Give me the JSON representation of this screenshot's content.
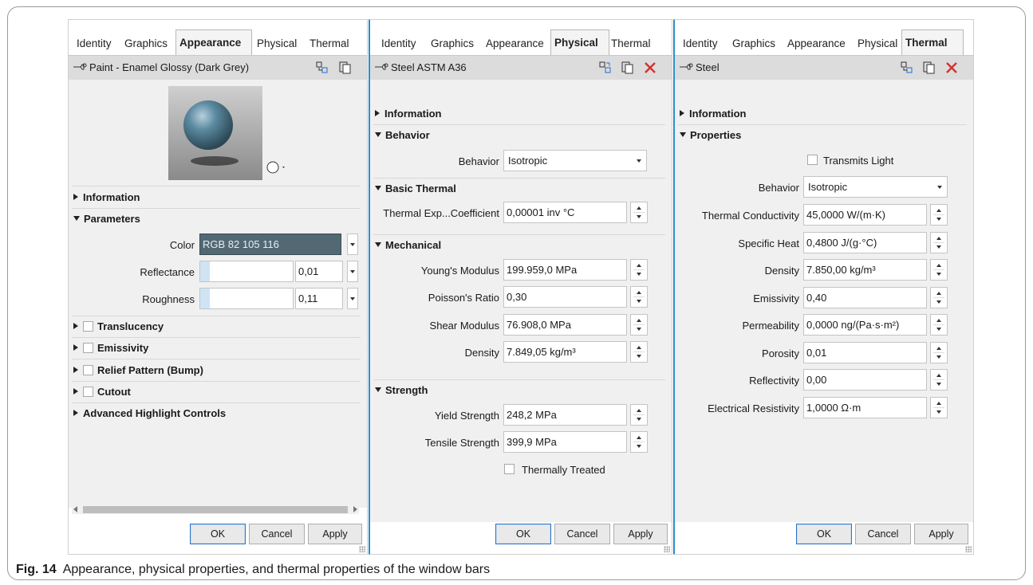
{
  "panel1": {
    "tabs": [
      "Identity",
      "Graphics",
      "Appearance",
      "Physical",
      "Thermal"
    ],
    "active_tab": "Appearance",
    "material_name": "Paint - Enamel Glossy (Dark Grey)",
    "sections": {
      "information": "Information",
      "parameters": "Parameters",
      "translucency": "Translucency",
      "emissivity": "Emissivity",
      "relief": "Relief Pattern (Bump)",
      "cutout": "Cutout",
      "advanced": "Advanced Highlight Controls"
    },
    "color_label": "Color",
    "color_value": "RGB 82 105 116",
    "color_swatch": "#526974",
    "reflectance_label": "Reflectance",
    "reflectance_value": "0,01",
    "roughness_label": "Roughness",
    "roughness_value": "0,11",
    "buttons": {
      "ok": "OK",
      "cancel": "Cancel",
      "apply": "Apply"
    }
  },
  "panel2": {
    "tabs": [
      "Identity",
      "Graphics",
      "Appearance",
      "Physical",
      "Thermal"
    ],
    "active_tab": "Physical",
    "material_name": "Steel ASTM A36",
    "sections": {
      "information": "Information",
      "behavior": "Behavior",
      "basic_thermal": "Basic Thermal",
      "mechanical": "Mechanical",
      "strength": "Strength"
    },
    "behavior_label": "Behavior",
    "behavior_value": "Isotropic",
    "thermal_exp_label": "Thermal Exp...Coefficient",
    "thermal_exp_value": "0,00001 inv °C",
    "youngs_label": "Young's Modulus",
    "youngs_value": "199.959,0 MPa",
    "poisson_label": "Poisson's Ratio",
    "poisson_value": "0,30",
    "shear_label": "Shear Modulus",
    "shear_value": "76.908,0 MPa",
    "density_label": "Density",
    "density_value": "7.849,05 kg/m³",
    "yield_label": "Yield Strength",
    "yield_value": "248,2 MPa",
    "tensile_label": "Tensile Strength",
    "tensile_value": "399,9 MPa",
    "thermally_treated": "Thermally Treated",
    "buttons": {
      "ok": "OK",
      "cancel": "Cancel",
      "apply": "Apply"
    }
  },
  "panel3": {
    "tabs": [
      "Identity",
      "Graphics",
      "Appearance",
      "Physical",
      "Thermal"
    ],
    "active_tab": "Thermal",
    "material_name": "Steel",
    "sections": {
      "information": "Information",
      "properties": "Properties"
    },
    "transmits_light": "Transmits Light",
    "behavior_label": "Behavior",
    "behavior_value": "Isotropic",
    "conductivity_label": "Thermal Conductivity",
    "conductivity_value": "45,0000 W/(m·K)",
    "specific_heat_label": "Specific Heat",
    "specific_heat_value": "0,4800 J/(g·°C)",
    "density_label": "Density",
    "density_value": "7.850,00 kg/m³",
    "emissivity_label": "Emissivity",
    "emissivity_value": "0,40",
    "permeability_label": "Permeability",
    "permeability_value": "0,0000 ng/(Pa·s·m²)",
    "porosity_label": "Porosity",
    "porosity_value": "0,01",
    "reflectivity_label": "Reflectivity",
    "reflectivity_value": "0,00",
    "resistivity_label": "Electrical Resistivity",
    "resistivity_value": "1,0000 Ω·m",
    "buttons": {
      "ok": "OK",
      "cancel": "Cancel",
      "apply": "Apply"
    }
  },
  "caption": {
    "label": "Fig. 14",
    "text": "Appearance, physical properties, and thermal properties of the window bars"
  }
}
